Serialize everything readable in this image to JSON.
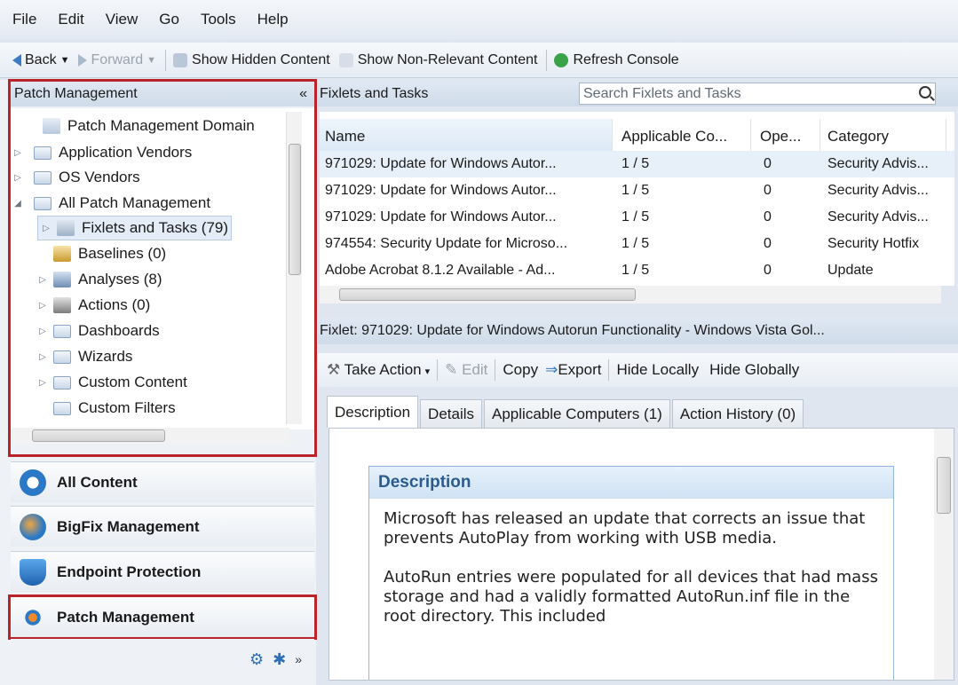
{
  "menu": [
    "File",
    "Edit",
    "View",
    "Go",
    "Tools",
    "Help"
  ],
  "toolbar": {
    "back": "Back",
    "forward": "Forward",
    "show_hidden": "Show Hidden Content",
    "show_non_relevant": "Show Non-Relevant Content",
    "refresh": "Refresh Console"
  },
  "left_panel": {
    "title": "Patch Management",
    "collapse": "«",
    "tree": [
      {
        "label": "Patch Management Domain",
        "level": 0
      },
      {
        "label": "Application Vendors",
        "level": 0
      },
      {
        "label": "OS Vendors",
        "level": 0
      },
      {
        "label": "All Patch Management",
        "level": 0
      },
      {
        "label": "Fixlets and Tasks (79)",
        "level": 1
      },
      {
        "label": "Baselines (0)",
        "level": 1
      },
      {
        "label": "Analyses (8)",
        "level": 1
      },
      {
        "label": "Actions (0)",
        "level": 1
      },
      {
        "label": "Dashboards",
        "level": 1
      },
      {
        "label": "Wizards",
        "level": 1
      },
      {
        "label": "Custom Content",
        "level": 1
      },
      {
        "label": "Custom Filters",
        "level": 1
      }
    ]
  },
  "nav": {
    "all_content": "All Content",
    "bigfix": "BigFix Management",
    "endpoint": "Endpoint Protection",
    "patch": "Patch Management"
  },
  "list_panel": {
    "title": "Fixlets and Tasks",
    "search_placeholder": "Search Fixlets and Tasks",
    "columns": [
      "Name",
      "Applicable Co...",
      "Ope...",
      "Category"
    ],
    "rows": [
      [
        "971029: Update for Windows Autor...",
        "1 / 5",
        "0",
        "Security Advis..."
      ],
      [
        "971029: Update for Windows Autor...",
        "1 / 5",
        "0",
        "Security Advis..."
      ],
      [
        "971029: Update for Windows Autor...",
        "1 / 5",
        "0",
        "Security Advis..."
      ],
      [
        "974554: Security Update for Microso...",
        "1 / 5",
        "0",
        "Security Hotfix"
      ],
      [
        "Adobe Acrobat 8.1.2 Available - Ad...",
        "1 / 5",
        "0",
        "Update"
      ]
    ]
  },
  "fixlet": {
    "header": "Fixlet: 971029: Update for Windows Autorun Functionality - Windows Vista Gol...",
    "actions": {
      "take_action": "Take Action",
      "edit": "Edit",
      "copy": "Copy",
      "export": "Export",
      "hide_locally": "Hide Locally",
      "hide_globally": "Hide Globally"
    },
    "tabs": [
      "Description",
      "Details",
      "Applicable Computers (1)",
      "Action History (0)"
    ],
    "desc_title": "Description",
    "desc_p1": "Microsoft has released an update that corrects an issue that prevents AutoPlay from working with USB media.",
    "desc_p2": "AutoRun entries were populated for all devices that had mass storage and had a validly formatted AutoRun.inf file in the root directory. This included"
  }
}
